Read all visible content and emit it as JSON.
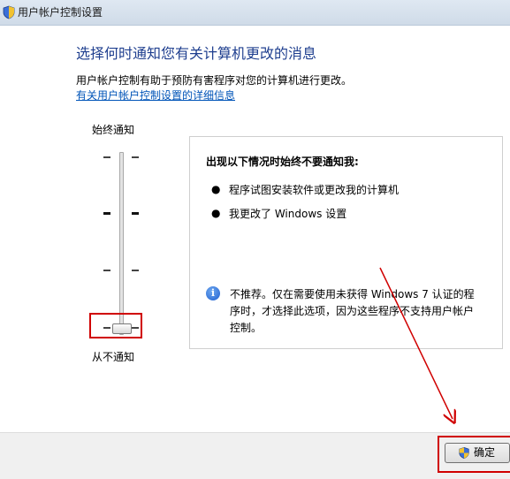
{
  "window": {
    "title": "用户帐户控制设置"
  },
  "header": {
    "title": "选择何时通知您有关计算机更改的消息",
    "description": "用户帐户控制有助于预防有害程序对您的计算机进行更改。",
    "more_info_link": "有关用户帐户控制设置的详细信息"
  },
  "slider": {
    "top_label": "始终通知",
    "bottom_label": "从不通知",
    "levels": 4,
    "selected_level": 1
  },
  "info_panel": {
    "heading": "出现以下情况时始终不要通知我:",
    "bullets": [
      "程序试图安装软件或更改我的计算机",
      "我更改了 Windows 设置"
    ],
    "note_line1": "不推荐。仅在需要使用未获得 Windows 7 认证的程",
    "note_line2": "序时，才选择此选项，因为这些程序不支持用户帐户",
    "note_line3": "控制。"
  },
  "footer": {
    "ok_label": "确定"
  },
  "icons": {
    "title_icon": "uac-shield-icon",
    "info_icon": "info-icon",
    "ok_icon": "uac-shield-icon"
  },
  "colors": {
    "title_blue": "#1f3f8f",
    "link_blue": "#0054b8",
    "annotation_red": "#d00000"
  }
}
